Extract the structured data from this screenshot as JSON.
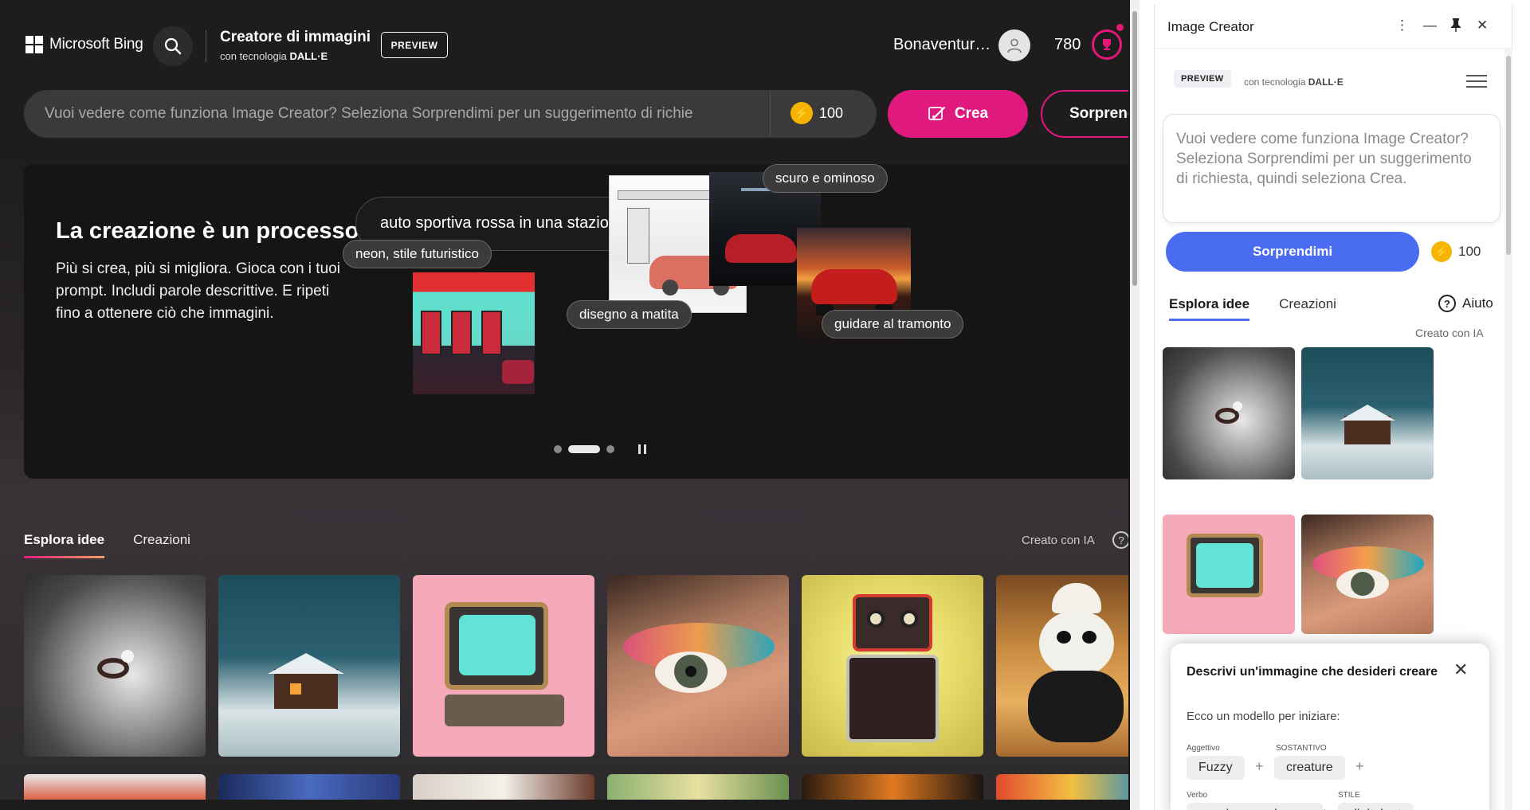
{
  "header": {
    "brand": "Microsoft Bing",
    "product_title": "Creatore di immagini",
    "product_sub_prefix": "con tecnologia ",
    "product_sub_model": "DALL·E",
    "preview_badge": "PREVIEW",
    "user_name": "Bonaventur…",
    "reward_points": "780"
  },
  "prompt": {
    "placeholder": "Vuoi vedere come funziona Image Creator? Seleziona Sorprendimi per un suggerimento di richie",
    "boosts": "100",
    "create_label": "Crea",
    "surprise_label": "Sorprendi"
  },
  "hero": {
    "title": "La creazione è un processo",
    "description": "Più si crea, più si migliora. Gioca con i tuoi prompt. Includi parole descrittive. E ripeti fino a ottenere ciò che immagini.",
    "sample_prompt": "auto sportiva rossa in una stazione di servizio",
    "tags": [
      "neon, stile futuristico",
      "disegno a matita",
      "scuro e ominoso",
      "guidare al tramonto"
    ]
  },
  "explore": {
    "tabs": [
      "Esplora idee",
      "Creazioni"
    ],
    "ai_label": "Creato con IA",
    "help_icon": "?"
  },
  "panel": {
    "title": "Image Creator",
    "preview_badge": "PREVIEW",
    "tech_prefix": "con tecnologia ",
    "tech_model": "DALL·E",
    "textarea_placeholder": "Vuoi vedere come funziona Image Creator? Seleziona Sorprendimi per un suggerimento di richiesta, quindi seleziona Crea.",
    "surprise_label": "Sorprendimi",
    "boosts": "100",
    "tabs": [
      "Esplora idee",
      "Creazioni"
    ],
    "help_label": "Aiuto",
    "ai_label": "Creato con IA",
    "tip": {
      "title": "Descrivi un'immagine che desideri creare",
      "subtitle": "Ecco un modello per iniziare:",
      "adj_label": "Aggettivo",
      "noun_label": "SOSTANTIVO",
      "verb_label": "Verbo",
      "style_label": "STILE",
      "adj_value": "Fuzzy",
      "noun_value": "creature",
      "verb_value": "wearing sunglasses",
      "style_value": "digital art"
    }
  },
  "colors": {
    "accent_pink": "#e0197f",
    "panel_blue": "#4a6cf0",
    "boost_gold": "#f4b400"
  }
}
